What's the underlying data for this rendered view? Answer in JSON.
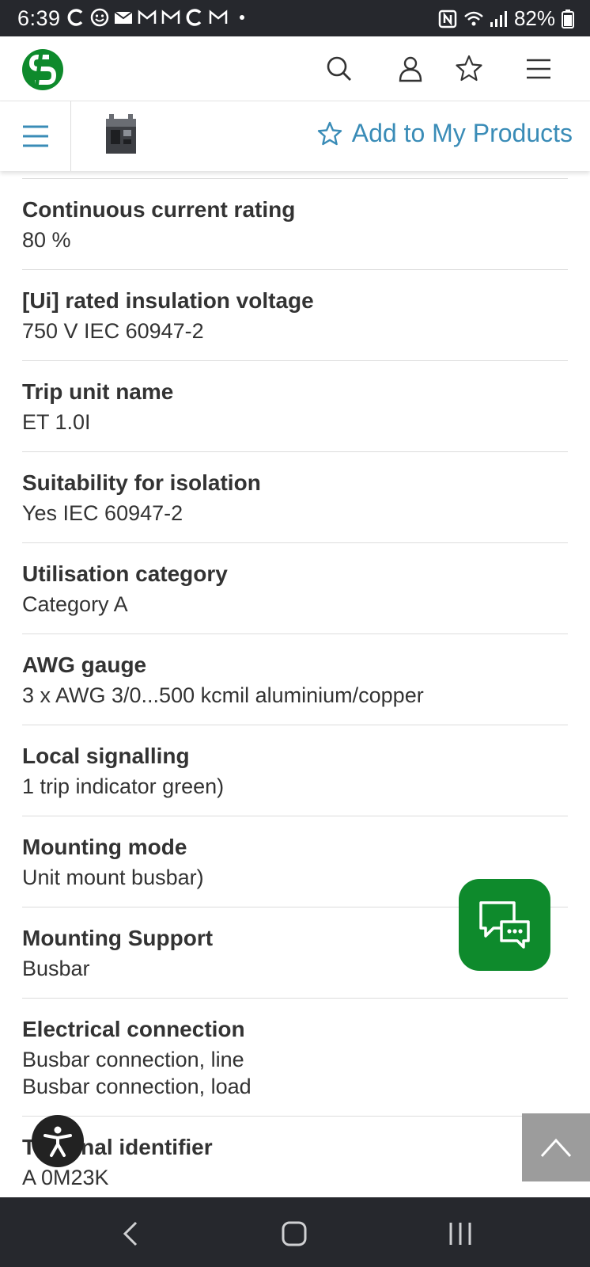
{
  "status_bar": {
    "time": "6:39",
    "battery": "82%"
  },
  "header": {
    "logo_icon": "schneider-logo-icon",
    "icons": [
      "search-icon",
      "user-icon",
      "star-icon",
      "hamburger-icon"
    ]
  },
  "product_bar": {
    "add_label": "Add to My Products"
  },
  "attributes": [
    {
      "label": "Continuous current rating",
      "value": "80 %"
    },
    {
      "label": "[Ui] rated insulation voltage",
      "value": "750 V IEC 60947-2"
    },
    {
      "label": "Trip unit name",
      "value": "ET 1.0I"
    },
    {
      "label": "Suitability for isolation",
      "value": "Yes IEC 60947-2"
    },
    {
      "label": "Utilisation category",
      "value": "Category A"
    },
    {
      "label": "AWG gauge",
      "value": "3 x AWG 3/0...500 kcmil aluminium/copper"
    },
    {
      "label": "Local signalling",
      "value": "1 trip indicator green)"
    },
    {
      "label": "Mounting mode",
      "value": "Unit mount busbar)"
    },
    {
      "label": "Mounting Support",
      "value": "Busbar"
    },
    {
      "label": "Electrical connection",
      "value": "Busbar connection, line",
      "value2": "Busbar connection, load"
    },
    {
      "label": "Terminal identifier",
      "value": "A  0M23K"
    }
  ],
  "colors": {
    "brand_green": "#0e8a2c",
    "link_blue": "#3a8cb7",
    "status_bar_bg": "#26282d"
  }
}
